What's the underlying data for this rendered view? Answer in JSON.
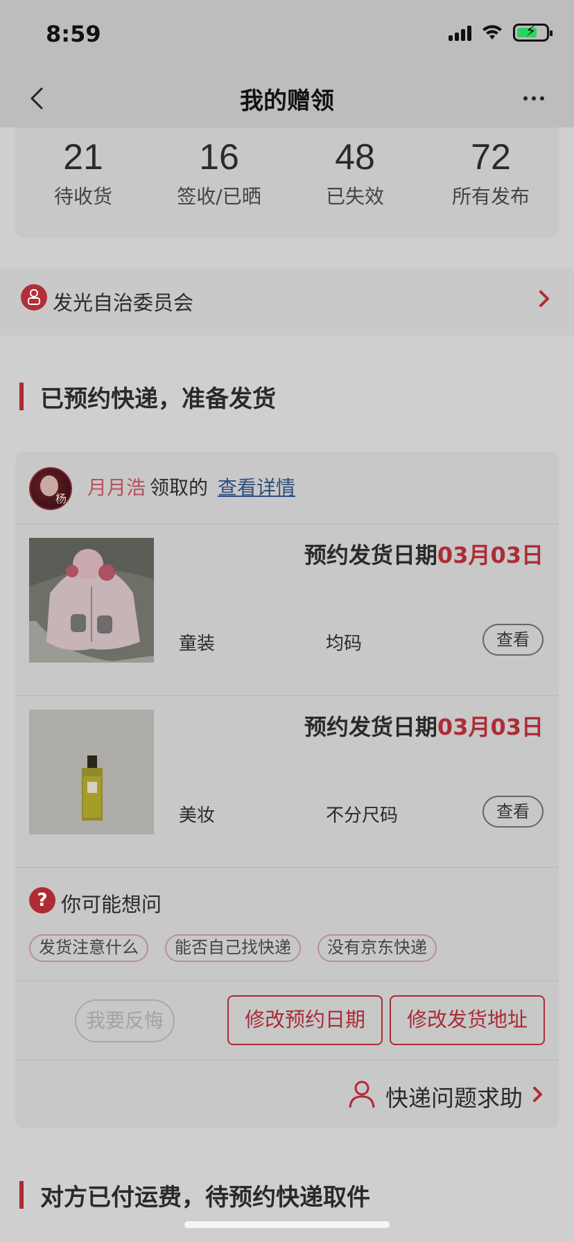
{
  "status_bar": {
    "time": "8:59"
  },
  "nav": {
    "title": "我的赠领"
  },
  "stats": [
    {
      "value": "21",
      "label": "待收货"
    },
    {
      "value": "16",
      "label": "签收/已晒"
    },
    {
      "value": "48",
      "label": "已失效"
    },
    {
      "value": "72",
      "label": "所有发布"
    }
  ],
  "committee": {
    "label": "发光自治委员会"
  },
  "sections": {
    "booked": "已预约快递，准备发货",
    "paid": "对方已付运费，待预约快递取件"
  },
  "order": {
    "receiver_name": "月月浩",
    "receiver_action": "领取的",
    "detail_link": "查看详情",
    "avatar_char": "杨",
    "items": [
      {
        "date_label": "预约发货日期",
        "date_value": "03月03日",
        "category": "童装",
        "size": "均码",
        "view_label": "查看"
      },
      {
        "date_label": "预约发货日期",
        "date_value": "03月03日",
        "category": "美妆",
        "size": "不分尺码",
        "view_label": "查看"
      }
    ],
    "faq": {
      "title": "你可能想问",
      "icon_glyph": "?",
      "tags": [
        "发货注意什么",
        "能否自己找快递",
        "没有京东快递"
      ]
    },
    "actions": {
      "regret": "我要反悔",
      "modify_date": "修改预约日期",
      "modify_address": "修改发货地址"
    },
    "help": {
      "label": "快递问题求助"
    }
  },
  "colors": {
    "accent": "#b02a33",
    "link": "#2d4f7e",
    "overlay_bg": "#cfcfcf"
  }
}
